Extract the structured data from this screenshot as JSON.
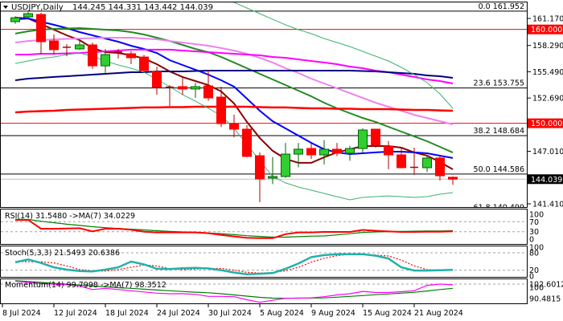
{
  "header": {
    "symbol": "USDJPY,Daily",
    "ohlc": "144.245 144.331 143.442 144.039"
  },
  "colors": {
    "up_body": "#32CD32",
    "up_border": "#006400",
    "down_body": "#FF0000",
    "down_border": "#B00000",
    "level_red": "#FF0000",
    "current_badge": "#000000"
  },
  "price_axis": {
    "labels": [
      "161.170",
      "158.290",
      "155.490",
      "152.690",
      "147.010",
      "141.410"
    ],
    "values": [
      161.17,
      158.29,
      155.49,
      152.69,
      147.01,
      141.41
    ]
  },
  "fib_levels": [
    {
      "label": "0.0 161.952",
      "price": 161.952
    },
    {
      "label": "23.6 153.755",
      "price": 153.755
    },
    {
      "label": "38.2 148.684",
      "price": 148.684
    },
    {
      "label": "50.0 144.586",
      "price": 144.586
    },
    {
      "label": "61.8 140.499",
      "price": 140.499
    }
  ],
  "levels": [
    {
      "label": "160.000",
      "price": 160.0
    },
    {
      "label": "150.000",
      "price": 150.0
    }
  ],
  "current_price": {
    "label": "144.039",
    "price": 144.039
  },
  "candles": [
    [
      160.83,
      161.4,
      160.6,
      161.25
    ],
    [
      161.34,
      161.85,
      161.2,
      161.68
    ],
    [
      161.6,
      161.77,
      157.32,
      158.69
    ],
    [
      158.78,
      159.46,
      157.32,
      157.84
    ],
    [
      158.1,
      158.43,
      157.15,
      158.05
    ],
    [
      157.92,
      158.9,
      157.8,
      158.35
    ],
    [
      158.35,
      158.6,
      155.8,
      156.12
    ],
    [
      156.12,
      157.92,
      155.27,
      157.32
    ],
    [
      157.6,
      157.92,
      156.9,
      157.58
    ],
    [
      157.41,
      157.7,
      156.3,
      156.98
    ],
    [
      157.06,
      157.3,
      155.5,
      155.61
    ],
    [
      155.52,
      156.03,
      153.04,
      153.81
    ],
    [
      153.85,
      154.07,
      151.85,
      153.83
    ],
    [
      153.9,
      154.84,
      153.04,
      153.65
    ],
    [
      153.65,
      154.3,
      152.7,
      153.9
    ],
    [
      153.98,
      155.7,
      152.4,
      152.7
    ],
    [
      152.79,
      153.9,
      149.6,
      149.96
    ],
    [
      149.96,
      150.9,
      148.5,
      149.37
    ],
    [
      149.37,
      149.8,
      146.38,
      146.46
    ],
    [
      146.54,
      146.9,
      141.58,
      144.06
    ],
    [
      144.15,
      146.4,
      143.5,
      144.32
    ],
    [
      144.32,
      147.9,
      144.2,
      146.71
    ],
    [
      146.71,
      147.9,
      145.3,
      147.23
    ],
    [
      147.31,
      147.8,
      146.2,
      146.63
    ],
    [
      146.63,
      148.2,
      145.6,
      147.23
    ],
    [
      147.23,
      147.9,
      146.5,
      146.8
    ],
    [
      146.8,
      147.6,
      146.0,
      147.31
    ],
    [
      147.31,
      149.45,
      146.9,
      149.28
    ],
    [
      149.37,
      149.4,
      147.4,
      147.66
    ],
    [
      147.57,
      148.1,
      145.1,
      146.63
    ],
    [
      146.63,
      147.3,
      145.2,
      145.26
    ],
    [
      145.3,
      147.4,
      144.5,
      145.26
    ],
    [
      145.26,
      146.6,
      144.8,
      146.29
    ],
    [
      146.29,
      146.6,
      143.9,
      144.4
    ],
    [
      144.245,
      144.331,
      143.442,
      144.039
    ]
  ],
  "overlays": [
    {
      "name": "ma-fast",
      "color": "#8B0000",
      "width": 2,
      "start": 0,
      "values": [
        161.26,
        161.17,
        160.57,
        159.97,
        159.37,
        158.86,
        158.01,
        157.58,
        157.49,
        157.24,
        156.9,
        156.29,
        155.52,
        154.93,
        154.5,
        154.07,
        153.39,
        152.11,
        150.14,
        148.43,
        147.06,
        146.21,
        145.78,
        145.78,
        146.38,
        146.89,
        147.23,
        147.57,
        147.57,
        147.57,
        147.4,
        146.89,
        146.55,
        145.86,
        145.09
      ]
    },
    {
      "name": "ma-blue",
      "color": "#0000FF",
      "width": 2,
      "start": 0,
      "values": [
        161.08,
        161.17,
        160.83,
        160.49,
        160.14,
        159.72,
        159.37,
        159.03,
        158.69,
        158.26,
        157.92,
        157.49,
        156.72,
        156.21,
        155.7,
        155.18,
        154.58,
        153.9,
        152.62,
        151.33,
        150.22,
        149.45,
        148.68,
        147.91,
        147.23,
        146.89,
        146.71,
        146.8,
        146.89,
        146.97,
        146.97,
        146.89,
        146.8,
        146.54,
        146.29
      ]
    },
    {
      "name": "ma-green",
      "color": "#228B22",
      "width": 2,
      "start": 0,
      "values": [
        159.55,
        159.8,
        159.97,
        160.06,
        160.1,
        160.14,
        160.06,
        159.97,
        159.89,
        159.72,
        159.46,
        159.12,
        158.77,
        158.35,
        157.92,
        157.58,
        157.06,
        156.47,
        155.87,
        155.27,
        154.67,
        154.07,
        153.47,
        152.87,
        152.19,
        151.59,
        151.08,
        150.56,
        150.14,
        149.62,
        149.11,
        148.6,
        148.08,
        147.48,
        146.88
      ]
    },
    {
      "name": "ma-violet",
      "color": "#EE82EE",
      "width": 2,
      "start": 0,
      "values": [
        158.6,
        158.77,
        158.86,
        158.95,
        158.99,
        159.03,
        159.07,
        159.12,
        159.12,
        159.12,
        159.03,
        158.95,
        158.77,
        158.6,
        158.43,
        158.26,
        158.01,
        157.75,
        157.41,
        156.98,
        156.47,
        155.87,
        155.35,
        154.75,
        154.24,
        153.73,
        153.21,
        152.7,
        152.19,
        151.76,
        151.33,
        150.9,
        150.56,
        150.22,
        149.88
      ]
    },
    {
      "name": "ma-magenta",
      "color": "#FF00FF",
      "width": 2,
      "start": 0,
      "values": [
        157.32,
        157.32,
        157.41,
        157.41,
        157.45,
        157.49,
        157.58,
        157.66,
        157.75,
        157.84,
        157.84,
        157.84,
        157.84,
        157.75,
        157.66,
        157.58,
        157.49,
        157.41,
        157.32,
        157.24,
        157.06,
        156.98,
        156.81,
        156.64,
        156.47,
        156.29,
        156.04,
        155.87,
        155.61,
        155.44,
        155.18,
        154.93,
        154.67,
        154.5,
        154.24
      ]
    },
    {
      "name": "ma-navy",
      "color": "#000080",
      "width": 2,
      "start": 0,
      "values": [
        154.58,
        154.75,
        154.84,
        154.93,
        155.01,
        155.1,
        155.18,
        155.27,
        155.35,
        155.44,
        155.44,
        155.52,
        155.52,
        155.52,
        155.57,
        155.61,
        155.61,
        155.61,
        155.61,
        155.61,
        155.61,
        155.61,
        155.61,
        155.61,
        155.61,
        155.61,
        155.61,
        155.57,
        155.52,
        155.44,
        155.35,
        155.27,
        155.1,
        155.01,
        154.84
      ]
    },
    {
      "name": "ma-red",
      "color": "#FF0000",
      "width": 2.5,
      "start": 0,
      "values": [
        151.16,
        151.25,
        151.29,
        151.33,
        151.42,
        151.46,
        151.5,
        151.55,
        151.59,
        151.63,
        151.68,
        151.68,
        151.72,
        151.72,
        151.76,
        151.76,
        151.76,
        151.76,
        151.76,
        151.72,
        151.68,
        151.68,
        151.63,
        151.59,
        151.59,
        151.55,
        151.55,
        151.5,
        151.5,
        151.5,
        151.46,
        151.42,
        151.42,
        151.37,
        151.33
      ]
    },
    {
      "name": "band-lower",
      "color": "#3CB371",
      "width": 1,
      "start": 0,
      "values": [
        156.38,
        156.64,
        156.9,
        157.06,
        157.32,
        157.49,
        157.15,
        156.64,
        156.21,
        155.87,
        155.44,
        154.67,
        153.9,
        153.04,
        152.36,
        151.59,
        150.82,
        149.45,
        147.74,
        146.03,
        144.32,
        143.64,
        143.21,
        142.86,
        142.52,
        142.18,
        141.84,
        142.09,
        142.18,
        142.26,
        142.18,
        142.09,
        142.18,
        142.44,
        142.61
      ]
    },
    {
      "name": "band-upper",
      "color": "#3CB371",
      "width": 1,
      "start": 17,
      "values": [
        162.88,
        162.28,
        161.68,
        161.08,
        160.49,
        159.97,
        159.55,
        159.03,
        158.6,
        158.18,
        157.66,
        157.15,
        156.64,
        155.95,
        155.18,
        154.33,
        153.13,
        151.59
      ]
    }
  ],
  "rsi": {
    "title": "RSI(14) 31.5480  ->MA(7) 34.0229",
    "scale_labels": [
      "100",
      "70",
      "30",
      "0"
    ],
    "scale_values": [
      100,
      70,
      30,
      0
    ],
    "levels": [
      70,
      30
    ],
    "line": {
      "color": "#FF0000",
      "values": [
        77,
        77,
        42,
        42,
        43,
        44,
        31,
        42,
        42,
        38,
        30,
        27,
        27,
        27,
        27,
        24,
        17,
        11,
        5,
        4,
        4,
        20,
        27,
        27,
        29,
        29,
        29,
        37,
        34,
        31,
        29,
        29,
        30,
        30,
        31.5
      ]
    },
    "ma": {
      "color": "#008000",
      "values": [
        80,
        79,
        72,
        66,
        60,
        55,
        50,
        46,
        43,
        40,
        37,
        34,
        31,
        29,
        28,
        25,
        22,
        18,
        14,
        11,
        8,
        8,
        10,
        12,
        13,
        17,
        22,
        27,
        29,
        30,
        31,
        32,
        33,
        33,
        34
      ]
    }
  },
  "stoch": {
    "title": "Stoch(5,3,3) 21.5493 20.6386",
    "scale_labels": [
      "100",
      "80",
      "20",
      "0"
    ],
    "scale_values": [
      100,
      80,
      20,
      0
    ],
    "levels": [
      80,
      20
    ],
    "k": {
      "color": "#20B2AA",
      "values": [
        47,
        57,
        45,
        30,
        22,
        17,
        16,
        22,
        30,
        50,
        40,
        25,
        24,
        27,
        28,
        26,
        20,
        12,
        6,
        8,
        10,
        25,
        43,
        65,
        72,
        75,
        75,
        75,
        70,
        60,
        30,
        19,
        19,
        20,
        21.5
      ]
    },
    "d": {
      "color": "#FF0000",
      "values": [
        50,
        49,
        49,
        45,
        35,
        22,
        18,
        17,
        22,
        30,
        38,
        35,
        25,
        22,
        24,
        26,
        26,
        20,
        13,
        10,
        12,
        18,
        30,
        48,
        61,
        70,
        75,
        74,
        72,
        69,
        55,
        35,
        22,
        20,
        20.6
      ]
    }
  },
  "momentum": {
    "title": "Momentum(14) 99.7998  ->MA(7) 98.3512",
    "scale_labels": [
      "100",
      "102.6012",
      "90.4815"
    ],
    "scale_values": [
      100,
      102.6012,
      90.4815
    ],
    "levels": [
      102.6
    ],
    "line": {
      "color": "#FF00FF",
      "values": [
        105,
        104,
        103,
        102.5,
        102,
        101,
        98,
        99,
        98,
        97,
        96,
        95,
        94.5,
        94.5,
        94,
        92.3,
        92.3,
        92,
        89.5,
        87.3,
        89,
        90.7,
        90.8,
        91,
        92,
        93.5,
        94.5,
        96.5,
        95.5,
        95.5,
        96.2,
        97,
        101.5,
        102.6,
        102
      ]
    },
    "ma": {
      "color": "#008000",
      "values": [
        105.5,
        104.8,
        104,
        103.2,
        102.5,
        101.8,
        101,
        100.3,
        99.6,
        99,
        98.3,
        97.6,
        97,
        96.4,
        95.8,
        95.3,
        94.5,
        93.5,
        92.5,
        91.5,
        90.8,
        90.7,
        90.8,
        90.9,
        91,
        91.6,
        92.3,
        93,
        93.7,
        94.3,
        95,
        95.7,
        96.8,
        98,
        99
      ]
    }
  },
  "dates": [
    {
      "label": "8 Jul 2024",
      "index": -1
    },
    {
      "label": "12 Jul 2024",
      "index": 3
    },
    {
      "label": "18 Jul 2024",
      "index": 7
    },
    {
      "label": "24 Jul 2024",
      "index": 11
    },
    {
      "label": "30 Jul 2024",
      "index": 15
    },
    {
      "label": "5 Aug 2024",
      "index": 19
    },
    {
      "label": "9 Aug 2024",
      "index": 23
    },
    {
      "label": "15 Aug 2024",
      "index": 27
    },
    {
      "label": "21 Aug 2024",
      "index": 31
    }
  ]
}
